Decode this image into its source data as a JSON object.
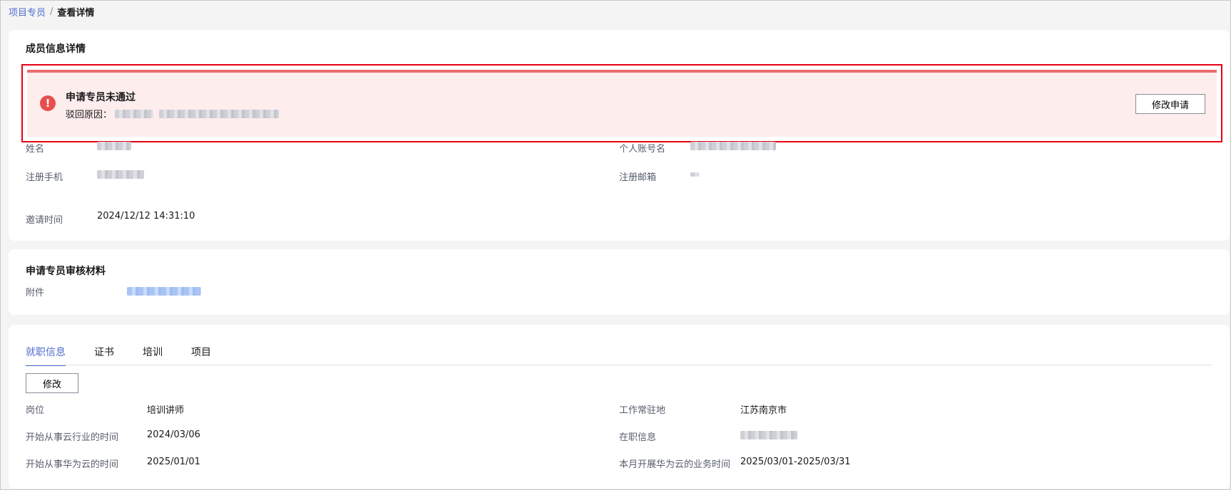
{
  "breadcrumb": {
    "parent": "项目专员",
    "separator": "/",
    "current": "查看详情"
  },
  "member_info": {
    "title": "成员信息详情",
    "alert": {
      "title": "申请专员未通过",
      "reason_label": "驳回原因：",
      "button": "修改申请"
    },
    "fields": {
      "name_label": "姓名",
      "account_label": "个人账号名",
      "phone_label": "注册手机",
      "email_label": "注册邮箱",
      "invite_time_label": "邀请时间",
      "invite_time_value": "2024/12/12 14:31:10"
    }
  },
  "materials": {
    "title": "申请专员审核材料",
    "attachment_label": "附件"
  },
  "employment": {
    "tabs": [
      {
        "label": "就职信息",
        "active": true
      },
      {
        "label": "证书",
        "active": false
      },
      {
        "label": "培训",
        "active": false
      },
      {
        "label": "项目",
        "active": false
      }
    ],
    "edit_button": "修改",
    "fields": {
      "position_label": "岗位",
      "position_value": "培训讲师",
      "location_label": "工作常驻地",
      "location_value": "江苏南京市",
      "cloud_industry_label": "开始从事云行业的时间",
      "cloud_industry_value": "2024/03/06",
      "job_info_label": "在职信息",
      "huawei_cloud_label": "开始从事华为云的时间",
      "huawei_cloud_value": "2025/01/01",
      "monthly_label": "本月开展华为云的业务时间",
      "monthly_value": "2025/03/01-2025/03/31"
    }
  },
  "colors": {
    "accent": "#526ecc",
    "error": "#e84e4e",
    "alert_bg": "#feeded",
    "highlight_border": "#e60012"
  }
}
